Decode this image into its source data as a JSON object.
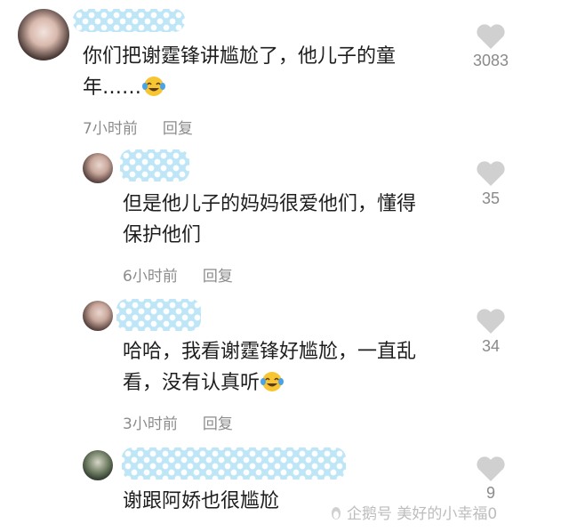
{
  "comments": [
    {
      "text_line1": "你们把谢霆锋讲尴尬了，他儿子的童",
      "text_line2": "年……",
      "time": "7小时前",
      "reply": "回复",
      "likes": "3083"
    },
    {
      "text_line1": "但是他儿子的妈妈很爱他们，懂得",
      "text_line2": "保护他们",
      "time": "6小时前",
      "reply": "回复",
      "likes": "35"
    },
    {
      "text_line1": "哈哈，我看谢霆锋好尴尬，一直乱",
      "text_line2": "看，没有认真听",
      "time": "3小时前",
      "reply": "回复",
      "likes": "34"
    },
    {
      "text_line1": "谢跟阿娇也很尴尬",
      "likes": "9"
    }
  ],
  "icons": {
    "like": "heart-icon",
    "emoji": "laughing-tears-emoji-icon"
  },
  "colors": {
    "mosaic": "#bfe6f7",
    "heart": "#d0d0d0",
    "meta_text": "#8c8c8c"
  },
  "watermark": "企鹅号 美好的小幸福0"
}
